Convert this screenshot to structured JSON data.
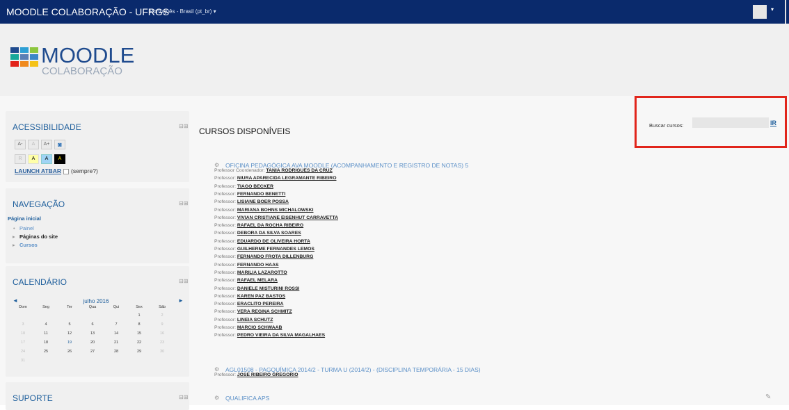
{
  "topbar": {
    "site_title": "MOODLE COLABORAÇÃO - UFRGS",
    "language": "Português - Brasil (pt_br) ▾",
    "user_menu_caret": "▾"
  },
  "logo": {
    "title": "MOODLE",
    "subtitle": "COLABORAÇÃO"
  },
  "blocks": {
    "acessibilidade": {
      "title": "ACESSIBILIDADE",
      "controls": "⊟⊞",
      "size_buttons": [
        "A-",
        "A",
        "A+"
      ],
      "color_buttons": [
        "R",
        "A",
        "A",
        "A"
      ],
      "launch_label": "LAUNCH ATBAR",
      "always_label": "(sempre?)"
    },
    "navegacao": {
      "title": "NAVEGAÇÃO",
      "controls": "⊟⊞",
      "home": "Página inicial",
      "items": [
        "Painel",
        "Páginas do site",
        "Cursos"
      ]
    },
    "calendario": {
      "title": "CALENDÁRIO",
      "controls": "⊟⊞",
      "month": "julho 2016",
      "prev": "◄",
      "next": "►",
      "weekdays": [
        "Dom",
        "Seg",
        "Ter",
        "Qua",
        "Qui",
        "Sex",
        "Sáb"
      ],
      "weeks": [
        [
          "",
          "",
          "",
          "",
          "",
          "1",
          "2"
        ],
        [
          "3",
          "4",
          "5",
          "6",
          "7",
          "8",
          "9"
        ],
        [
          "10",
          "11",
          "12",
          "13",
          "14",
          "15",
          "16"
        ],
        [
          "17",
          "18",
          "19",
          "20",
          "21",
          "22",
          "23"
        ],
        [
          "24",
          "25",
          "26",
          "27",
          "28",
          "29",
          "30"
        ],
        [
          "31",
          "",
          "",
          "",
          "",
          "",
          ""
        ]
      ]
    },
    "suporte": {
      "title": "SUPORTE",
      "controls": "⊟⊞"
    }
  },
  "main": {
    "title": "CURSOS DISPONÍVEIS",
    "search_label": "Buscar cursos:",
    "search_value": "",
    "search_button": "IR",
    "courses": [
      {
        "name": "OFICINA PEDAGÓGICA AVA MOODLE (ACOMPANHAMENTO E REGISTRO DE NOTAS) 5",
        "teachers": [
          {
            "role": "Professor Coordenador:",
            "name": "TANIA RODRIGUES DA CRUZ"
          },
          {
            "role": "Professor:",
            "name": "NIURA APARECIDA LEGRAMANTE RIBEIRO"
          },
          {
            "role": "Professor:",
            "name": "TIAGO BECKER"
          },
          {
            "role": "Professor:",
            "name": "FERNANDO BENETTI"
          },
          {
            "role": "Professor:",
            "name": "LISIANE BOER POSSA"
          },
          {
            "role": "Professor:",
            "name": "MARIANA BOHNS MICHALOWSKI"
          },
          {
            "role": "Professor:",
            "name": "VIVIAN CRISTIANE EISENHUT CARRAVETTA"
          },
          {
            "role": "Professor:",
            "name": "RAFAEL DA ROCHA RIBEIRO"
          },
          {
            "role": "Professor:",
            "name": "DEBORA DA SILVA SOARES"
          },
          {
            "role": "Professor:",
            "name": "EDUARDO DE OLIVEIRA HORTA"
          },
          {
            "role": "Professor:",
            "name": "GUILHERME FERNANDES LEMOS"
          },
          {
            "role": "Professor:",
            "name": "FERNANDO FROTA DILLENBURG"
          },
          {
            "role": "Professor:",
            "name": "FERNANDO HAAS"
          },
          {
            "role": "Professor:",
            "name": "MARILIA LAZAROTTO"
          },
          {
            "role": "Professor:",
            "name": "RAFAEL MELARA"
          },
          {
            "role": "Professor:",
            "name": "DANIELE MISTURINI ROSSI"
          },
          {
            "role": "Professor:",
            "name": "KAREN PAZ BASTOS"
          },
          {
            "role": "Professor:",
            "name": "ERACLITO PEREIRA"
          },
          {
            "role": "Professor:",
            "name": "VERA REGINA SCHMITZ"
          },
          {
            "role": "Professor:",
            "name": "LINEIA SCHUTZ"
          },
          {
            "role": "Professor:",
            "name": "MARCIO SCHWAAB"
          },
          {
            "role": "Professor:",
            "name": "PEDRO VIEIRA DA SILVA MAGALHAES"
          }
        ]
      },
      {
        "name": "AGL01508 - PAGQUÍMICA 2014/2 - TURMA U (2014/2) - (DISCIPLINA TEMPORÁRIA - 15 DIAS)",
        "teachers": [
          {
            "role": "Professor:",
            "name": "JOSE RIBEIRO GREGORIO"
          }
        ]
      },
      {
        "name": "QUALIFICA APS",
        "teachers": []
      }
    ]
  },
  "colors": {
    "topbar": "#0a2a6c",
    "link": "#1f5f9c",
    "highlight_box": "#e1251b"
  }
}
